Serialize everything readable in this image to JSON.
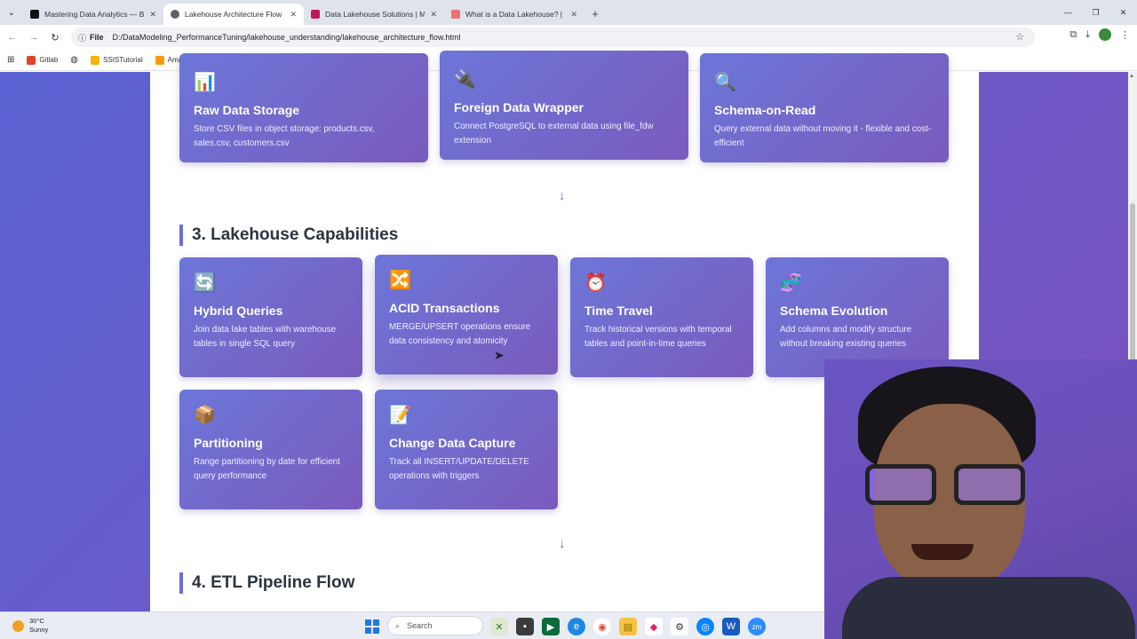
{
  "browser": {
    "tabs": [
      {
        "title": "Mastering Data Analytics — Be",
        "active": false,
        "favicon_color": "#111111"
      },
      {
        "title": "Lakehouse Architecture Flow",
        "active": true,
        "favicon_color": "#5f6368"
      },
      {
        "title": "Data Lakehouse Solutions | Mi",
        "active": false,
        "favicon_color": "#c2185b"
      },
      {
        "title": "What is a Data Lakehouse? | Da",
        "active": false,
        "favicon_color": "#e57373"
      }
    ],
    "address": {
      "scheme_label": "File",
      "url": "D:/DataModeling_PerformanceTuning/lakehouse_understanding/lakehouse_architecture_flow.html"
    },
    "bookmarks": [
      {
        "label": "Gitlab",
        "color": "#e24329"
      },
      {
        "label": "SSISTutorial",
        "color": "#f4b400"
      },
      {
        "label": "Amazon Web Servic...",
        "color": "#ff9900"
      }
    ]
  },
  "page": {
    "section2_cards": [
      {
        "icon": "📊",
        "title": "Raw Data Storage",
        "desc": "Store CSV files in object storage: products.csv, sales.csv, customers.csv"
      },
      {
        "icon": "🔌",
        "title": "Foreign Data Wrapper",
        "desc": "Connect PostgreSQL to external data using file_fdw extension"
      },
      {
        "icon": "🔍",
        "title": "Schema-on-Read",
        "desc": "Query external data without moving it - flexible and cost-efficient"
      }
    ],
    "arrow": "↓",
    "section3": {
      "title": "3. Lakehouse Capabilities",
      "cards": [
        {
          "icon": "🔄",
          "title": "Hybrid Queries",
          "desc": "Join data lake tables with warehouse tables in single SQL query"
        },
        {
          "icon": "🔀",
          "title": "ACID Transactions",
          "desc": "MERGE/UPSERT operations ensure data consistency and atomicity"
        },
        {
          "icon": "⏰",
          "title": "Time Travel",
          "desc": "Track historical versions with temporal tables and point-in-time queries"
        },
        {
          "icon": "🧬",
          "title": "Schema Evolution",
          "desc": "Add columns and modify structure without breaking existing queries"
        },
        {
          "icon": "📦",
          "title": "Partitioning",
          "desc": "Range partitioning by date for efficient query performance"
        },
        {
          "icon": "📝",
          "title": "Change Data Capture",
          "desc": "Track all INSERT/UPDATE/DELETE operations with triggers"
        }
      ]
    },
    "section4": {
      "title": "4. ETL Pipeline Flow"
    }
  },
  "taskbar": {
    "weather_temp": "30°C",
    "weather_desc": "Sunny",
    "search_placeholder": "Search"
  }
}
